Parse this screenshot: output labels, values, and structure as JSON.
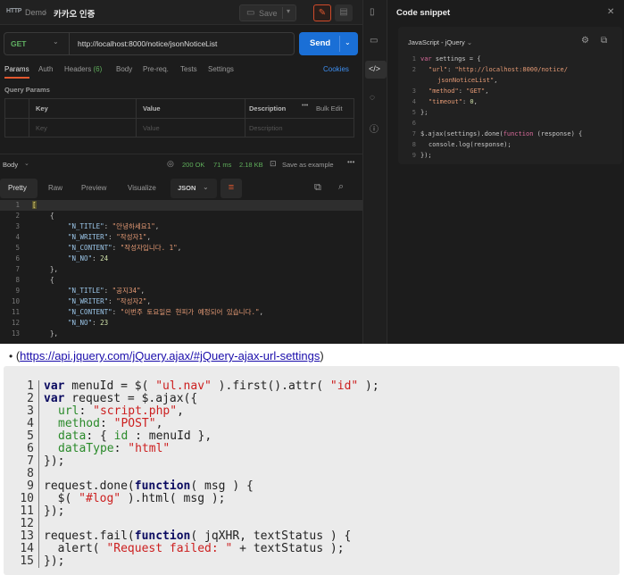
{
  "app": {
    "logo": "HTTP",
    "breadcrumb": {
      "root": "Demo",
      "separator": "/",
      "leaf": "카카오 인증"
    },
    "save_label": "Save"
  },
  "request": {
    "method": "GET",
    "url": "http://localhost:8000/notice/jsonNoticeList",
    "send_label": "Send",
    "tabs": {
      "params": "Params",
      "auth": "Auth",
      "headers": "Headers",
      "headers_count": "(6)",
      "body": "Body",
      "prereq": "Pre-req.",
      "tests": "Tests",
      "settings": "Settings"
    },
    "cookies_label": "Cookies",
    "query_params_label": "Query Params",
    "table": {
      "headers": {
        "key": "Key",
        "value": "Value",
        "description": "Description",
        "bulk_edit": "Bulk Edit"
      },
      "placeholders": {
        "key": "Key",
        "value": "Value",
        "description": "Description"
      }
    }
  },
  "response": {
    "body_label": "Body",
    "status": "200 OK",
    "time": "71 ms",
    "size": "2.18 KB",
    "save_example_label": "Save as example",
    "view_tabs": {
      "pretty": "Pretty",
      "raw": "Raw",
      "preview": "Preview",
      "visualize": "Visualize"
    },
    "format": "JSON",
    "lines": {
      "n1": "1",
      "n2": "2",
      "n3": "3",
      "n4": "4",
      "n5": "5",
      "n6": "6",
      "n7": "7",
      "n8": "8",
      "n9": "9",
      "n10": "10",
      "n11": "11",
      "n12": "12",
      "n13": "13",
      "open_bracket": "[",
      "open_brace": "{",
      "close_brace": "},",
      "k_title": "\"N_TITLE\"",
      "k_writer": "\"N_WRITER\"",
      "k_content": "\"N_CONTENT\"",
      "k_no": "\"N_NO\"",
      "colon": ": ",
      "comma": ",",
      "item1_title": "\"안녕하세요1\"",
      "item1_writer": "\"작성자1\"",
      "item1_content": "\"작성자입니다. 1\"",
      "item1_no": "24",
      "item2_title": "\"공지34\"",
      "item2_writer": "\"작성자2\"",
      "item2_content": "\"이번주 토요일은 현피가 예정되어 있습니다.\"",
      "item2_no": "23"
    }
  },
  "snippet": {
    "title": "Code snippet",
    "language": "JavaScript - jQuery",
    "lines": {
      "n1": "1",
      "n2": "2",
      "n3": "",
      "n4": "3",
      "n5": "4",
      "n6": "5",
      "n7": "6",
      "n8": "7",
      "n9": "8",
      "n10": "9",
      "l1_kw": "var",
      "l1_rest": " settings = {",
      "l2_key": "\"url\"",
      "l2_val": "\"http://localhost:8000/notice/",
      "l2b_val": "jsonNoticeList\"",
      "l3_key": "\"method\"",
      "l3_val": "\"GET\"",
      "l4_key": "\"timeout\"",
      "l4_val": "0",
      "l5": "};",
      "l7_a": "$.ajax(settings).done(",
      "l7_kw": "function",
      "l7_b": " (response) {",
      "l8": "console.log(response);",
      "l9": "});"
    }
  },
  "webpage": {
    "bullet": "•",
    "link_open": "(",
    "link_text": "https://api.jquery.com/jQuery.ajax/#jQuery-ajax-url-settings",
    "link_close": ")",
    "code": {
      "n1": "1",
      "n2": "2",
      "n3": "3",
      "n4": "4",
      "n5": "5",
      "n6": "6",
      "n7": "7",
      "n8": "8",
      "n9": "9",
      "n10": "10",
      "n11": "11",
      "n12": "12",
      "n13": "13",
      "n14": "14",
      "n15": "15",
      "var": "var",
      "l1_a": " menuId = $( ",
      "l1_s": "\"ul.nav\"",
      "l1_b": " ).first().attr( ",
      "l1_s2": "\"id\"",
      "l1_c": " );",
      "l2_a": " request = $.ajax({",
      "url": "url",
      "l3_s": "\"script.php\"",
      "method": "method",
      "l4_s": "\"POST\"",
      "data": "data",
      "l5_a": ": { ",
      "id": "id",
      "l5_b": " : menuId },",
      "dataType": "dataType",
      "l6_s": "\"html\"",
      "close": "});",
      "l9_a": "request.done(",
      "function": "function",
      "l9_b": "( msg ) {",
      "l10_a": "  $( ",
      "l10_s": "\"#log\"",
      "l10_b": " ).html( msg );",
      "l13_a": "request.fail(",
      "l13_b": "( jqXHR, textStatus ) {",
      "l14_a": "  alert( ",
      "l14_s": "\"Request failed: \"",
      "l14_b": " + textStatus );",
      "colon": ": ",
      "comma": ","
    }
  }
}
